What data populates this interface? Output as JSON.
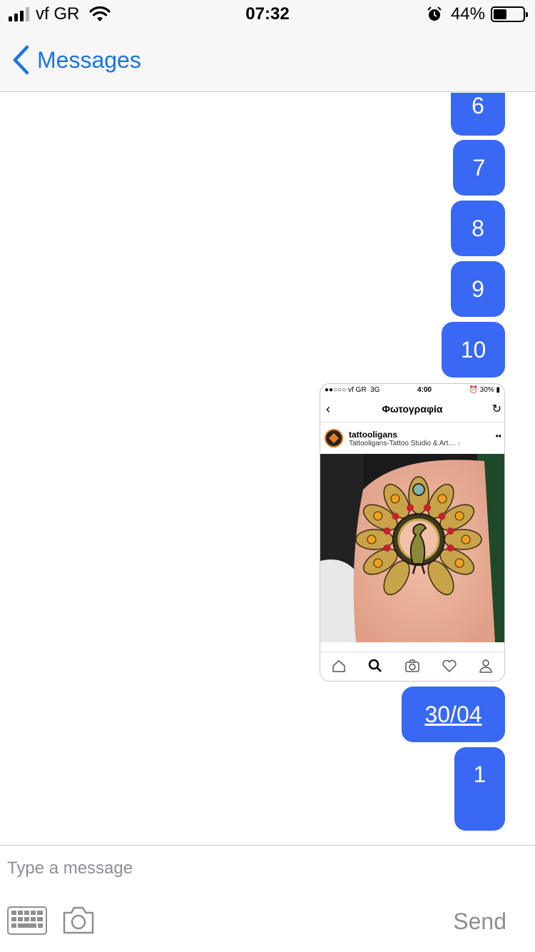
{
  "status_bar": {
    "carrier": "vf GR",
    "time": "07:32",
    "battery_percent": "44%",
    "battery_level": 0.44
  },
  "nav": {
    "back_label": "Messages"
  },
  "messages": {
    "m6": "6",
    "m7": "7",
    "m8": "8",
    "m9": "9",
    "m10": "10",
    "date": "30/04",
    "m1": "1"
  },
  "shared_screenshot": {
    "carrier": "vf GR",
    "network": "3G",
    "time": "4:00",
    "battery": "30%",
    "title": "Φωτογραφία",
    "username": "tattooligans",
    "location": "Tattooligans-Tattoo Studio & Art…"
  },
  "composer": {
    "placeholder": "Type a message",
    "send_label": "Send"
  },
  "colors": {
    "bubble": "#3968f5",
    "accent": "#1a73e8"
  }
}
